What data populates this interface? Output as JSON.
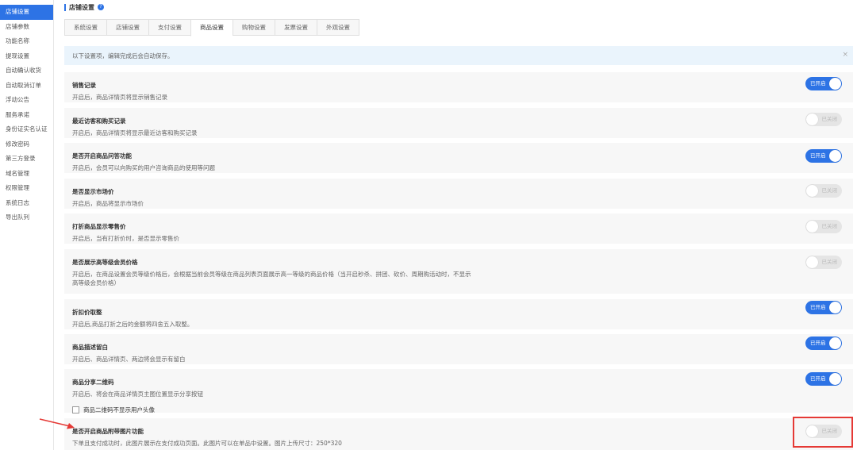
{
  "sidebar": {
    "items": [
      {
        "label": "店铺设置",
        "active": true
      },
      {
        "label": "店铺参数"
      },
      {
        "label": "功能名称"
      },
      {
        "label": "提现设置"
      },
      {
        "label": "自动确认收货"
      },
      {
        "label": "自动取消订单"
      },
      {
        "label": "浮动公告"
      },
      {
        "label": "服务承诺"
      },
      {
        "label": "身份证实名认证"
      },
      {
        "label": "修改密码"
      },
      {
        "label": "第三方登录"
      },
      {
        "label": "域名管理"
      },
      {
        "label": "权限管理"
      },
      {
        "label": "系统日志"
      },
      {
        "label": "导出队列"
      }
    ]
  },
  "header": {
    "title": "店铺设置",
    "help_icon": "?"
  },
  "tabs": [
    {
      "label": "系统设置"
    },
    {
      "label": "店铺设置"
    },
    {
      "label": "支付设置"
    },
    {
      "label": "商品设置",
      "active": true
    },
    {
      "label": "购物设置"
    },
    {
      "label": "发票设置"
    },
    {
      "label": "外观设置"
    }
  ],
  "tip": {
    "text": "以下设置项，编辑完成后会自动保存。",
    "close": "×"
  },
  "settings": [
    {
      "title": "销售记录",
      "desc": "开启后，商品详情页将显示销售记录",
      "state": "on",
      "state_label": "已开启"
    },
    {
      "title": "最近访客和购买记录",
      "desc": "开启后，商品详情页将显示最近访客和购买记录",
      "state": "off",
      "state_label": "已关闭"
    },
    {
      "title": "是否开启商品问答功能",
      "desc": "开启后，会员可以向购买的用户咨询商品的使用等问题",
      "state": "on",
      "state_label": "已开启"
    },
    {
      "title": "是否显示市场价",
      "desc": "开启后，商品将显示市场价",
      "state": "off",
      "state_label": "已关闭"
    },
    {
      "title": "打折商品显示零售价",
      "desc": "开启后，当有打折价时，是否显示零售价",
      "state": "off",
      "state_label": "已关闭"
    },
    {
      "title": "是否展示高等级会员价格",
      "desc": "开启后，在商品设置会员等级价格后，会根据当前会员等级在商品列表页面展示高一等级的商品价格（当开启秒杀、拼团、砍价、周期购活动时，不显示高等级会员价格）",
      "state": "off",
      "state_label": "已关闭"
    },
    {
      "title": "折扣价取整",
      "desc": "开启后,商品打折之后的金额将四舍五入取整。",
      "state": "on",
      "state_label": "已开启"
    },
    {
      "title": "商品描述留白",
      "desc": "开启后、商品详情页、两边将会显示有留白",
      "state": "on",
      "state_label": "已开启"
    },
    {
      "title": "商品分享二维码",
      "desc": "开启后、将会在商品详情页主图位置显示分享按钮",
      "state": "on",
      "state_label": "已开启",
      "checkbox_label": "商品二维码不显示用户头像"
    },
    {
      "title": "是否开启商品附带图片功能",
      "desc": "下单且支付成功时，此图片展示在支付成功页面。此图片可以在单品中设置。图片上传尺寸：250*320",
      "state": "off",
      "state_label": "已关闭"
    }
  ]
}
